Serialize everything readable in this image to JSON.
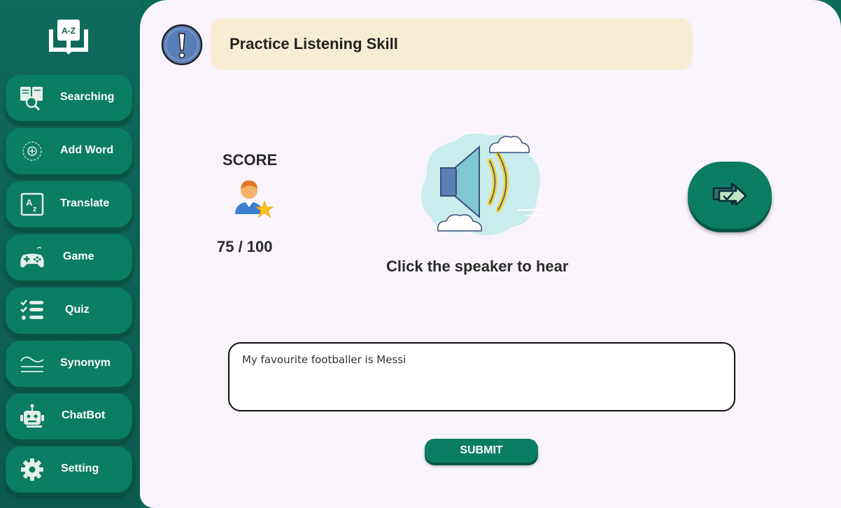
{
  "sidebar": {
    "logo_text": "A-Z",
    "items": [
      {
        "label": "Searching",
        "icon": "book-search-icon"
      },
      {
        "label": "Add Word",
        "icon": "plus-circle-icon"
      },
      {
        "label": "Translate",
        "icon": "translate-icon"
      },
      {
        "label": "Game",
        "icon": "gamepad-icon"
      },
      {
        "label": "Quiz",
        "icon": "checklist-icon"
      },
      {
        "label": "Synonym",
        "icon": "waves-icon"
      },
      {
        "label": "ChatBot",
        "icon": "robot-icon"
      },
      {
        "label": "Setting",
        "icon": "gear-icon"
      }
    ]
  },
  "header": {
    "title": "Practice Listening Skill",
    "icon": "exclamation-icon"
  },
  "score": {
    "label": "SCORE",
    "value": "75 / 100",
    "icon": "user-star-icon"
  },
  "speaker": {
    "icon": "speaker-icon",
    "hint": "Click the speaker to hear"
  },
  "next_button": {
    "icon": "next-arrow-check-icon"
  },
  "answer": {
    "value": "My favourite footballer is Messi"
  },
  "submit": {
    "label": "SUBMIT"
  },
  "colors": {
    "sidebar": "#0a5a4d",
    "button": "#0b7d62",
    "background": "#f9f4fb",
    "header_bar": "#f7edd3"
  }
}
